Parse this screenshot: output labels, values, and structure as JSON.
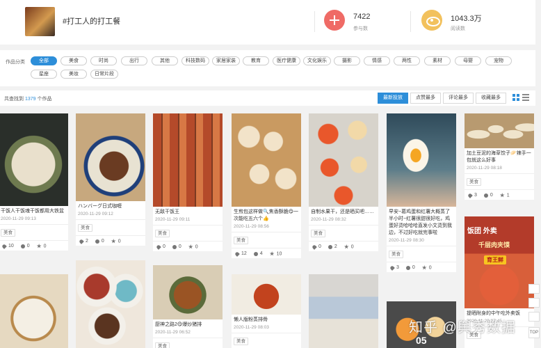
{
  "topic": {
    "title": "#打工人的打工餐",
    "participants_value": "7422",
    "participants_label": "参与数",
    "views_value": "1043.3万",
    "views_label": "阅读数"
  },
  "categories": {
    "label": "作品分类",
    "chips": [
      "全部",
      "美食",
      "时尚",
      "出行",
      "其他",
      "科技数码",
      "家居家装",
      "教育",
      "医疗健康",
      "文化娱乐",
      "摄影",
      "情感",
      "两性",
      "素材",
      "母婴",
      "宠物",
      "星座",
      "美妆",
      "日常片段"
    ]
  },
  "results": {
    "prefix": "共查找到",
    "count": "1379",
    "suffix": "个作品"
  },
  "sort": [
    "最新投放",
    "点赞最多",
    "评论最多",
    "收藏最多"
  ],
  "cards": [
    {
      "title": "干饭人干饭魂干饭都用大铁盆",
      "date": "2020-11-29 09:13",
      "tag": "美食",
      "likes": "10",
      "comments": "0",
      "stars": "0"
    },
    {
      "title": "ハンバーグ日式咖喱",
      "date": "2020-11-29 09:12",
      "tag": "美食",
      "likes": "2",
      "comments": "0",
      "stars": "0"
    },
    {
      "title": "无敌干饭王",
      "date": "2020-11-29 09:11",
      "tag": "美食",
      "likes": "0",
      "comments": "0",
      "stars": "0"
    },
    {
      "title": "生煎包这样做🔍焦香酥脆😋一次能吃五六个👍",
      "date": "2020-11-29 08:56",
      "tag": "美食",
      "likes": "12",
      "comments": "4",
      "stars": "10"
    },
    {
      "title": "自制水果干，还是晒买吧……",
      "date": "2020-11-29 08:32",
      "tag": "美食",
      "likes": "0",
      "comments": "2",
      "stars": "0"
    },
    {
      "title": "早安~葛鸡蛋和红薯大概蒸了半小时~红薯很甜很好吃，鸡蛋好烫哈哈哈直发小文烫到我边，不过好吃就完事啦",
      "date": "2020-11-29 08:30",
      "tag": "美食",
      "likes": "3",
      "comments": "0",
      "stars": "0"
    },
    {
      "title": "加土豆泥的海草饺子🥟辣手一包就这么好事",
      "date": "2020-11-29 08:18",
      "tag": "美食",
      "likes": "3",
      "comments": "0",
      "stars": "1"
    },
    {
      "title": "厨神之路2😋爆炒猪排",
      "date": "2020-11-29 06:52",
      "tag": "美食"
    },
    {
      "title": "懒人版粉蒸排骨",
      "date": "2020-11-29 08:03",
      "tag": "美食"
    },
    {
      "title": "提晒附身的中午吃外卖饭",
      "date": "2020-11-29 07:45",
      "tag": "美食"
    }
  ],
  "overlays": {
    "takeaway_text": "饭团 外卖",
    "badge_text": "育王鲜",
    "dish_text": "千层肉夹馍",
    "egg_label": "05"
  },
  "side_buttons": [
    "TOP"
  ],
  "watermark": "知乎 @舆秀数据",
  "colors": {
    "accent": "#2d8ed9",
    "plus": "#ef6b66",
    "eye": "#f2c15d"
  }
}
